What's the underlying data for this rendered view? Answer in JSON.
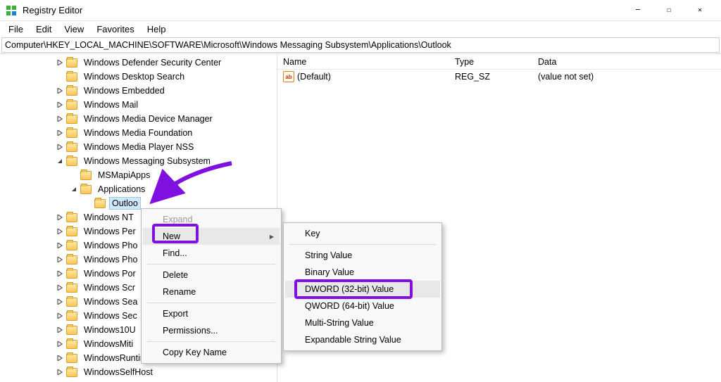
{
  "titlebar": {
    "title": "Registry Editor"
  },
  "menubar": [
    "File",
    "Edit",
    "View",
    "Favorites",
    "Help"
  ],
  "address": "Computer\\HKEY_LOCAL_MACHINE\\SOFTWARE\\Microsoft\\Windows Messaging Subsystem\\Applications\\Outlook",
  "tree": {
    "indent_base": 78,
    "nodes": [
      {
        "label": "Windows Defender Security Center",
        "exp": ">",
        "depth": 0
      },
      {
        "label": "Windows Desktop Search",
        "exp": "",
        "depth": 0
      },
      {
        "label": "Windows Embedded",
        "exp": ">",
        "depth": 0
      },
      {
        "label": "Windows Mail",
        "exp": ">",
        "depth": 0
      },
      {
        "label": "Windows Media Device Manager",
        "exp": ">",
        "depth": 0
      },
      {
        "label": "Windows Media Foundation",
        "exp": ">",
        "depth": 0
      },
      {
        "label": "Windows Media Player NSS",
        "exp": ">",
        "depth": 0
      },
      {
        "label": "Windows Messaging Subsystem",
        "exp": "v",
        "depth": 0
      },
      {
        "label": "MSMapiApps",
        "exp": "",
        "depth": 1
      },
      {
        "label": "Applications",
        "exp": "v",
        "depth": 1
      },
      {
        "label": "Outlook",
        "exp": "",
        "depth": 2,
        "selected": true,
        "truncate_after": 6
      },
      {
        "label": "Windows NT",
        "exp": ">",
        "depth": 0,
        "cut": true
      },
      {
        "label": "Windows Per",
        "exp": ">",
        "depth": 0,
        "cut": true
      },
      {
        "label": "Windows Pho",
        "exp": ">",
        "depth": 0,
        "cut": true
      },
      {
        "label": "Windows Pho",
        "exp": ">",
        "depth": 0,
        "cut": true
      },
      {
        "label": "Windows Por",
        "exp": ">",
        "depth": 0,
        "cut": true
      },
      {
        "label": "Windows Scr",
        "exp": ">",
        "depth": 0,
        "cut": true
      },
      {
        "label": "Windows Sea",
        "exp": ">",
        "depth": 0,
        "cut": true
      },
      {
        "label": "Windows Sec",
        "exp": ">",
        "depth": 0,
        "cut": true
      },
      {
        "label": "Windows10U",
        "exp": ">",
        "depth": 0,
        "cut": true
      },
      {
        "label": "WindowsMiti",
        "exp": ">",
        "depth": 0,
        "cut": true
      },
      {
        "label": "WindowsRuntime",
        "exp": ">",
        "depth": 0
      },
      {
        "label": "WindowsSelfHost",
        "exp": ">",
        "depth": 0
      }
    ]
  },
  "list": {
    "headers": {
      "name": "Name",
      "type": "Type",
      "data": "Data"
    },
    "rows": [
      {
        "icon": "ab",
        "name": "(Default)",
        "type": "REG_SZ",
        "data": "(value not set)"
      }
    ]
  },
  "context_menu_1": {
    "items": [
      {
        "label": "Expand",
        "disabled": true
      },
      {
        "label": "New",
        "hover": true,
        "submenu": true
      },
      {
        "label": "Find...",
        "sep_after": true
      },
      {
        "label": "Delete"
      },
      {
        "label": "Rename",
        "sep_after": true
      },
      {
        "label": "Export"
      },
      {
        "label": "Permissions...",
        "sep_after": true
      },
      {
        "label": "Copy Key Name"
      }
    ]
  },
  "context_menu_2": {
    "items": [
      {
        "label": "Key",
        "sep_after": true
      },
      {
        "label": "String Value"
      },
      {
        "label": "Binary Value"
      },
      {
        "label": "DWORD (32-bit) Value",
        "hover": true
      },
      {
        "label": "QWORD (64-bit) Value"
      },
      {
        "label": "Multi-String Value"
      },
      {
        "label": "Expandable String Value"
      }
    ]
  }
}
